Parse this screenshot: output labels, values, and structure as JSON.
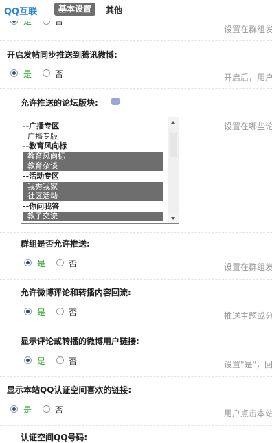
{
  "header": {
    "brand": "QQ互联",
    "tab_active": "基本设置",
    "tab_other": "其他"
  },
  "top_partial": {
    "yes": "是",
    "no": "否",
    "hint": "设置在群组发"
  },
  "sections": {
    "weibo_push": {
      "label": "开启发帖同步推送到腾讯微博:",
      "yes": "是",
      "no": "否",
      "hint": "开启后，用户"
    },
    "forums": {
      "label": "允许推送的论坛版块:",
      "hint": "设置在哪些论"
    },
    "group_push": {
      "label": "群组是否允许推送:",
      "yes": "是",
      "no": "否",
      "hint": "设置在群组发"
    },
    "comment_return": {
      "label": "允许微博评论和转播内容回流:",
      "yes": "是",
      "no": "否",
      "hint": "推送主题或分"
    },
    "user_link": {
      "label": "显示评论或转播的微博用户链接:",
      "yes": "是",
      "no": "否",
      "hint": "设置\"是\"，回"
    },
    "qzone_like": {
      "label": "显示本站QQ认证空间喜欢的链接:",
      "yes": "是",
      "no": "否",
      "hint": "用户点击本站"
    },
    "bottom_partial": {
      "label": "认证空间QQ号码:"
    }
  },
  "forum_list": [
    {
      "label": "--广播专区",
      "group": true,
      "selected": false
    },
    {
      "label": "  广播专版",
      "group": false,
      "selected": false
    },
    {
      "label": "--教育风向标",
      "group": true,
      "selected": false
    },
    {
      "label": "  教育风向标",
      "group": false,
      "selected": true
    },
    {
      "label": "  教育杂谈",
      "group": false,
      "selected": true
    },
    {
      "label": "--活动专区",
      "group": true,
      "selected": false
    },
    {
      "label": "  我秀我家",
      "group": false,
      "selected": true
    },
    {
      "label": "  社区活动",
      "group": false,
      "selected": true
    },
    {
      "label": "--你问我答",
      "group": true,
      "selected": false
    },
    {
      "label": "  教子交流",
      "group": false,
      "selected": true
    }
  ]
}
